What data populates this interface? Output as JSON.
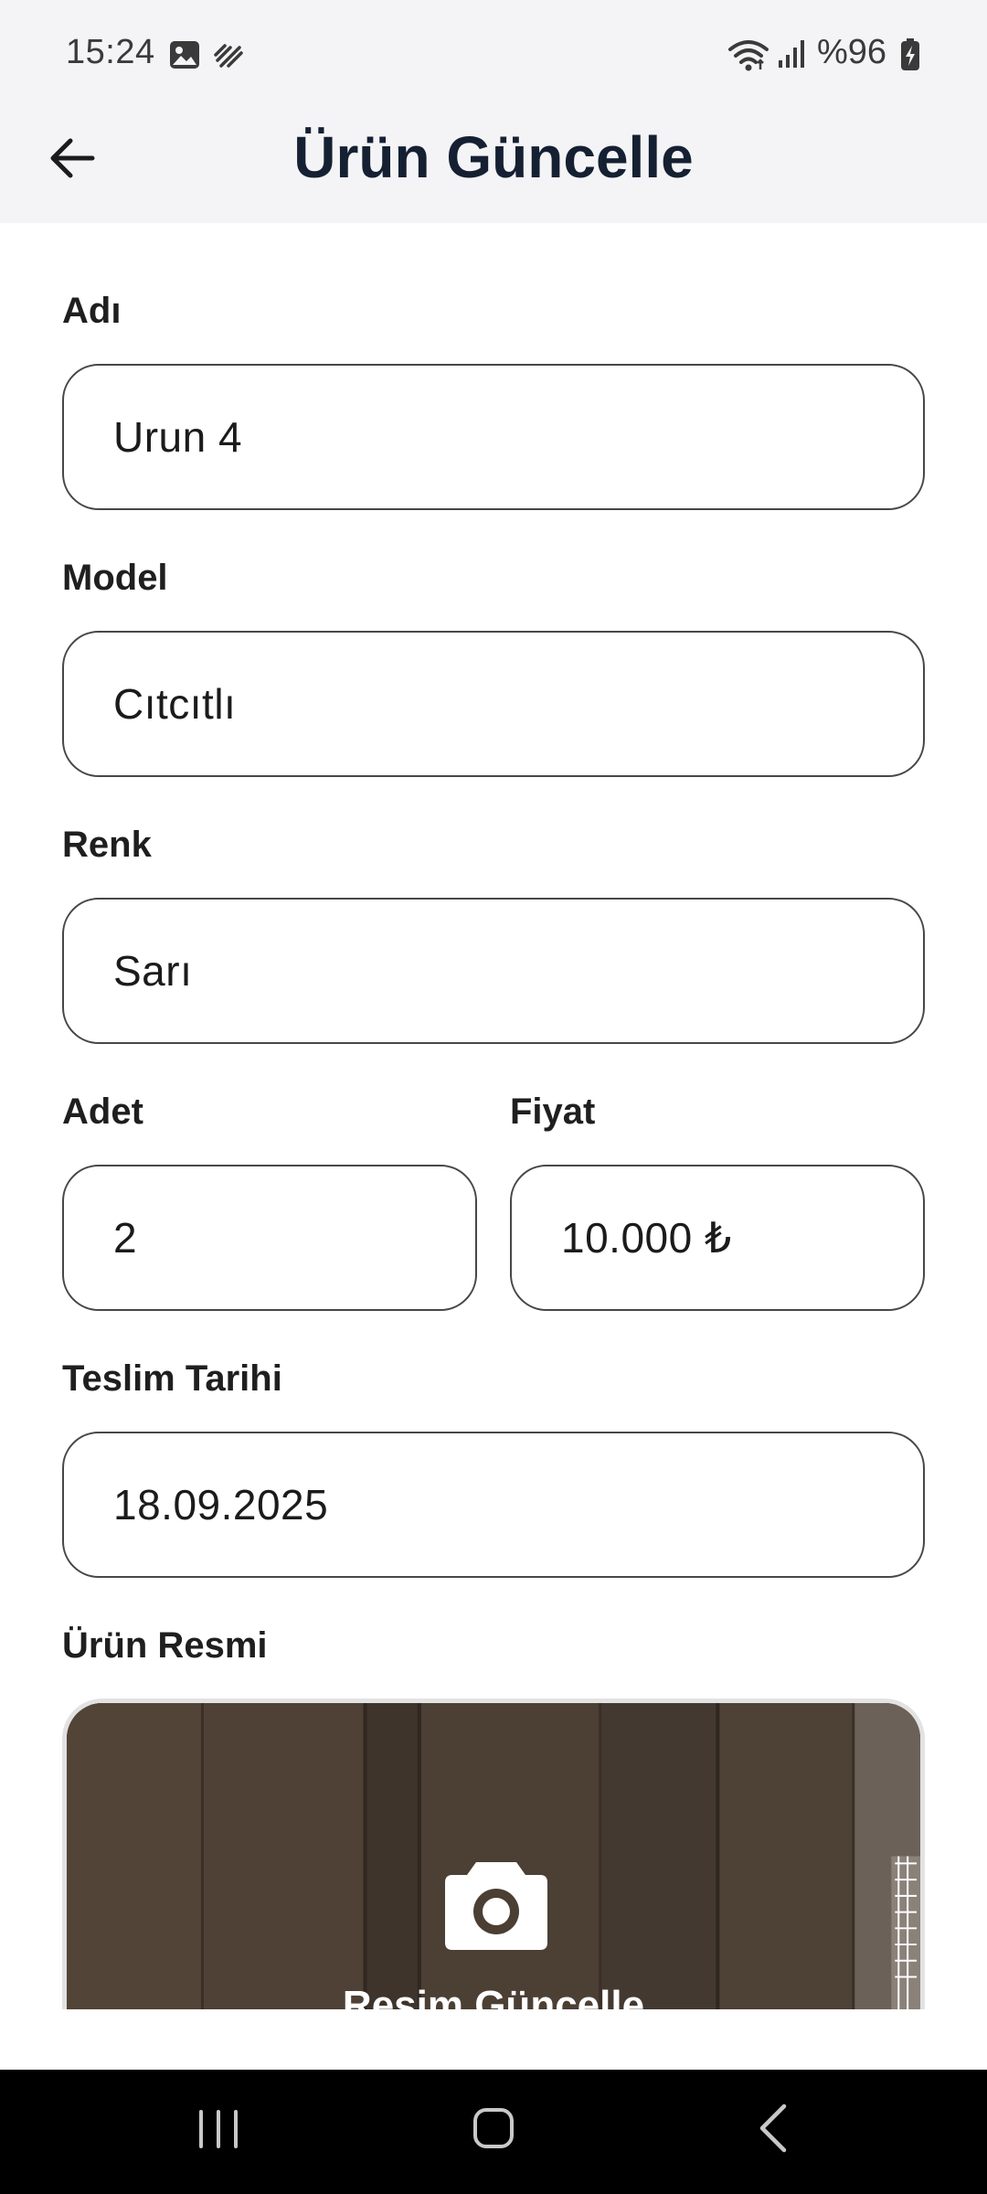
{
  "status_bar": {
    "time": "15:24",
    "battery": "%96",
    "icons": [
      "photo-icon",
      "wave-icon",
      "wifi-icon",
      "signal-icon",
      "battery-charging-icon"
    ]
  },
  "app_bar": {
    "title": "Ürün Güncelle",
    "back_icon": "arrow-left-icon"
  },
  "form": {
    "name": {
      "label": "Adı",
      "value": "Urun 4"
    },
    "model": {
      "label": "Model",
      "value": "Cıtcıtlı"
    },
    "color": {
      "label": "Renk",
      "value": "Sarı"
    },
    "quantity": {
      "label": "Adet",
      "value": "2"
    },
    "price": {
      "label": "Fiyat",
      "value": "10.000 ₺"
    },
    "delivery_date": {
      "label": "Teslim Tarihi",
      "value": "18.09.2025"
    },
    "image": {
      "label": "Ürün Resmi",
      "button_label": "Resim Güncelle",
      "icon": "camera-icon"
    }
  },
  "nav_bar": {
    "icons": [
      "recents-icon",
      "home-icon",
      "back-icon"
    ]
  },
  "colors": {
    "title": "#152033",
    "bar_background": "#f4f4f6",
    "input_border": "#474747",
    "photo_background": "#4b3e33"
  }
}
